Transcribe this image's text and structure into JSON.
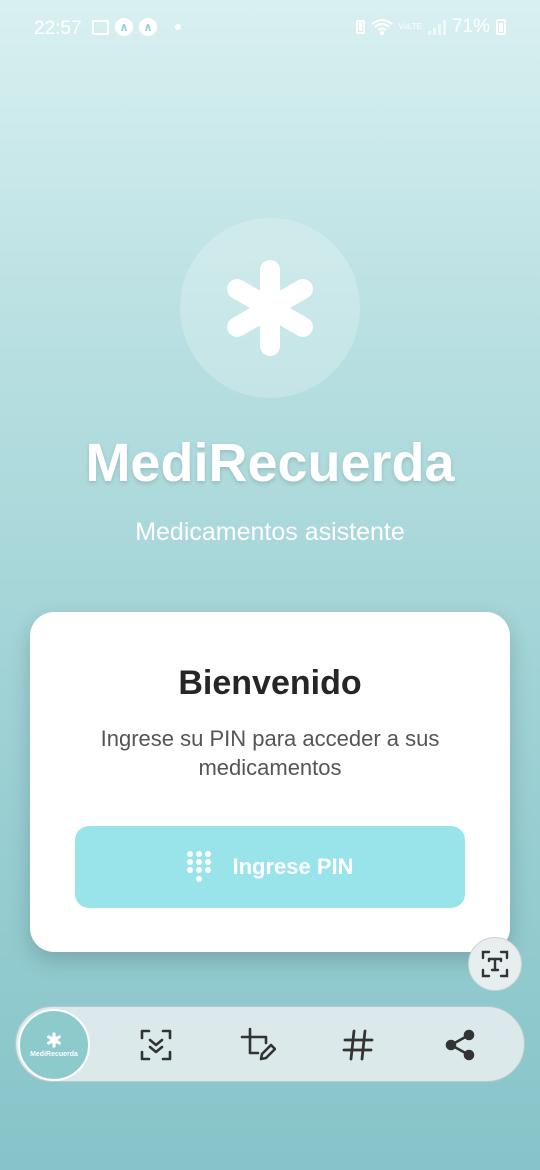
{
  "status_bar": {
    "time": "22:57",
    "battery": "71%",
    "network": "VoLTE"
  },
  "app": {
    "title": "MediRecuerda",
    "subtitle": "Medicamentos asistente",
    "logo_icon": "asterisk-icon"
  },
  "card": {
    "title": "Bienvenido",
    "description": "Ingrese su PIN para acceder a sus medicamentos",
    "pin_button_label": "Ingrese PIN",
    "pin_button_icon": "dialpad-icon"
  },
  "toolbar": {
    "app_label": "MediRecuerda",
    "items": [
      "scan-icon",
      "crop-edit-icon",
      "hashtag-icon",
      "share-icon"
    ]
  },
  "colors": {
    "accent": "#98e4ea",
    "background_top": "#d9f0f1",
    "background_bottom": "#86c4c9",
    "card_title": "#262626"
  }
}
